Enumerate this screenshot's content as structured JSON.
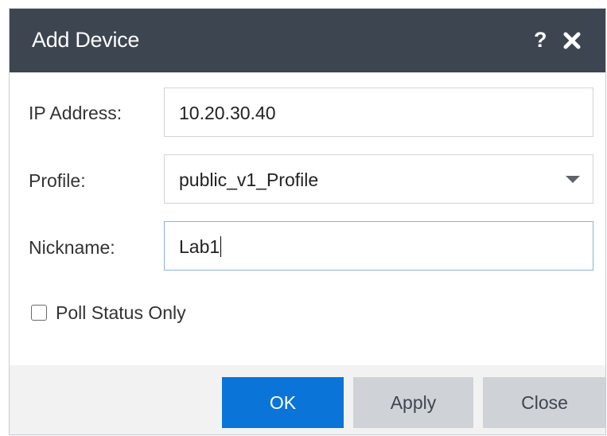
{
  "dialog": {
    "title": "Add Device",
    "help_label": "?",
    "close_icon": "close-icon"
  },
  "form": {
    "ip_address": {
      "label": "IP Address:",
      "value": "10.20.30.40"
    },
    "profile": {
      "label": "Profile:",
      "value": "public_v1_Profile",
      "icon": "chevron-down-icon"
    },
    "nickname": {
      "label": "Nickname:",
      "value": "Lab1"
    },
    "poll_status_only": {
      "label": "Poll Status Only",
      "checked": false
    }
  },
  "buttons": {
    "ok": "OK",
    "apply": "Apply",
    "close": "Close"
  },
  "colors": {
    "titlebar": "#3d4551",
    "primary_button": "#0a74d8",
    "secondary_button": "#cfd3d8",
    "footer": "#f2f2f2"
  }
}
